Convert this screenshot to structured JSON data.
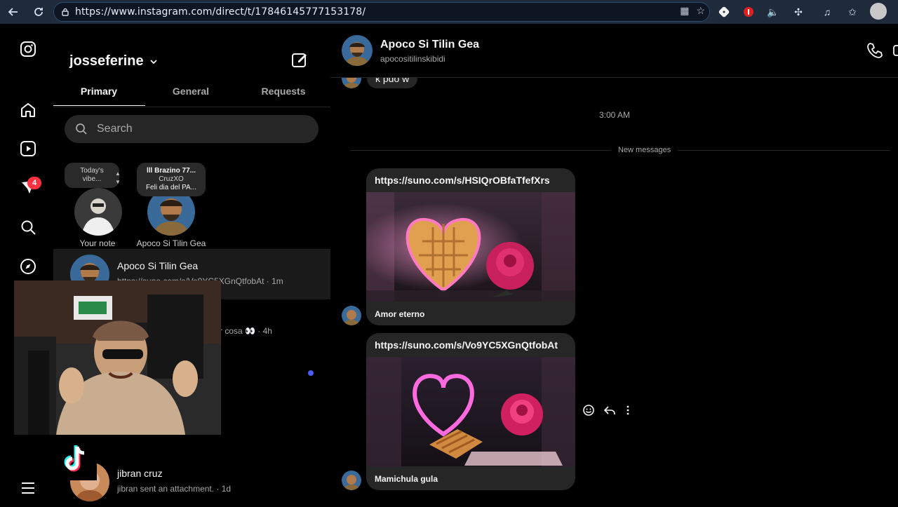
{
  "browser": {
    "url": "https://www.instagram.com/direct/t/17846145777153178/",
    "back_icon": "arrow-left-icon",
    "reload_icon": "reload-icon"
  },
  "sidebar": {
    "notification_count": "4",
    "items": [
      {
        "name": "instagram-logo-icon"
      },
      {
        "name": "home-icon"
      },
      {
        "name": "reels-icon"
      },
      {
        "name": "messages-icon"
      },
      {
        "name": "search-icon"
      },
      {
        "name": "explore-icon"
      },
      {
        "name": "menu-icon"
      }
    ]
  },
  "inbox": {
    "username": "josseferine",
    "tabs": [
      "Primary",
      "General",
      "Requests"
    ],
    "search_placeholder": "Search",
    "notes": [
      {
        "bubble_line1": "Today's",
        "bubble_line2": "vibe...",
        "label": "Your note"
      },
      {
        "bubble_line1": "lll Brazino 77...",
        "bubble_line2": "CruzXO",
        "bubble_line3": "Feli dia del PA...",
        "label": "Apoco Si Tilin Gea"
      }
    ],
    "threads": [
      {
        "name": "Apoco Si Tilin Gea",
        "preview": "https://suno.com/s/Vo9YC5XGnQtfobAt · 1m",
        "active": true
      },
      {
        "name": "",
        "preview": "r cosa 👀 · 4h",
        "active": false
      },
      {
        "name": "jibran cruz",
        "preview": "jibran sent an attachment. · 1d",
        "active": false
      }
    ]
  },
  "chat": {
    "contact_name": "Apoco Si Tilin Gea",
    "contact_handle": "apocositilinskibidi",
    "partial_message": "k pdo w",
    "time_separator": "3:00 AM",
    "new_messages_label": "New messages",
    "cards": [
      {
        "link": "https://suno.com/s/HSIQrOBfaTfefXrs",
        "title": "Amor eterno"
      },
      {
        "link": "https://suno.com/s/Vo9YC5XGnQtfobAt",
        "title": "Mamichula gula"
      }
    ]
  },
  "colors": {
    "background": "#000000",
    "bubble": "#262626",
    "badge": "#ff3040",
    "unread_dot": "#4a5df0"
  }
}
